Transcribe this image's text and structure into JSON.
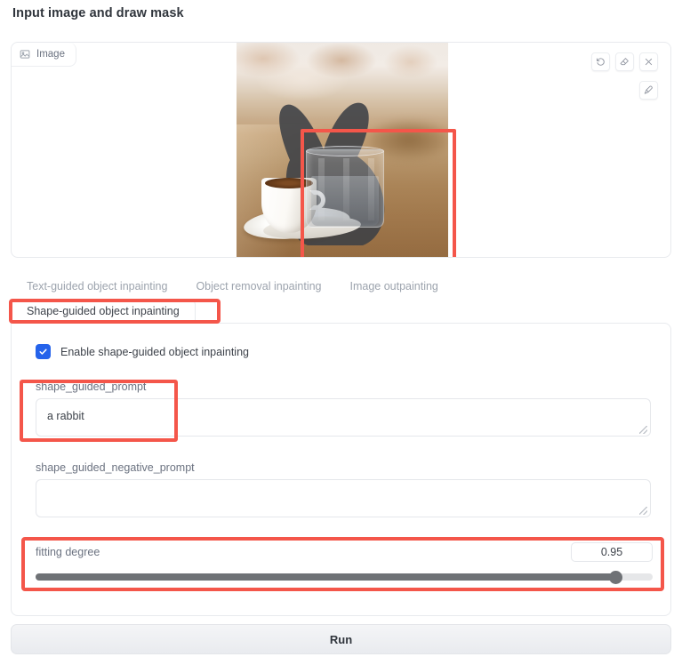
{
  "page": {
    "title": "Input image and draw mask"
  },
  "image_panel": {
    "tab_label": "Image",
    "tab_icon": "image-icon",
    "tools": [
      {
        "name": "undo-icon",
        "label": "Undo"
      },
      {
        "name": "eraser-icon",
        "label": "Erase"
      },
      {
        "name": "close-icon",
        "label": "Clear"
      }
    ],
    "brush_tool": {
      "name": "brush-icon",
      "label": "Brush"
    },
    "annotation": {
      "color": "#f4564a",
      "shape": "rectangle"
    },
    "content_description": "Photo of a coffee cup and drinking glass on a wooden table with a dark rabbit-shaped mask drawn over them"
  },
  "tabs": [
    {
      "label": "Text-guided object inpainting",
      "active": false
    },
    {
      "label": "Object removal inpainting",
      "active": false
    },
    {
      "label": "Image outpainting",
      "active": false
    }
  ],
  "active_tab": {
    "label": "Shape-guided object inpainting",
    "active": true
  },
  "settings": {
    "enable_checkbox": {
      "label": "Enable shape-guided object inpainting",
      "checked": true,
      "accent": "#2563eb"
    },
    "prompt": {
      "label": "shape_guided_prompt",
      "value": "a rabbit",
      "placeholder": ""
    },
    "negative_prompt": {
      "label": "shape_guided_negative_prompt",
      "value": "",
      "placeholder": ""
    },
    "fitting_degree": {
      "label": "fitting degree",
      "value": "0.95",
      "min": 0,
      "max": 1,
      "percent": 95
    }
  },
  "run_button": {
    "label": "Run"
  },
  "colors": {
    "annotation_red": "#f4564a",
    "checkbox_blue": "#2563eb",
    "slider_fill": "#6f7276",
    "border": "#e8eaee"
  }
}
